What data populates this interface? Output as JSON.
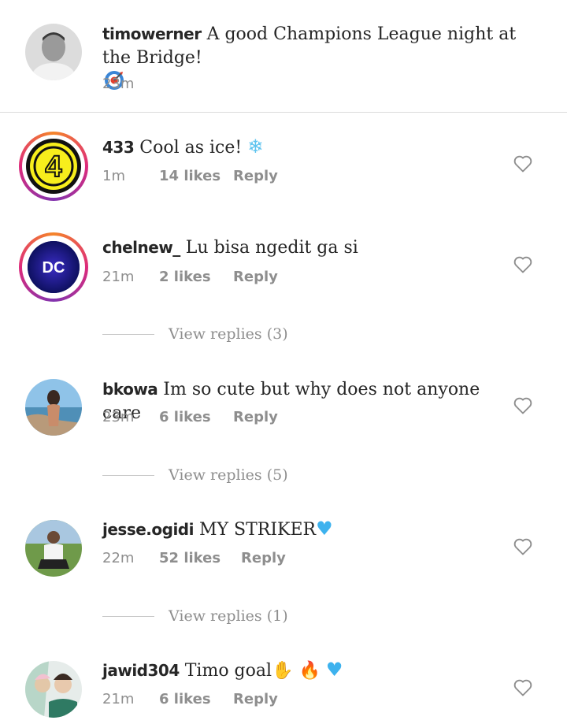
{
  "caption": {
    "username": "timowerner",
    "text": "A good Champions League night at the Bridge!",
    "time": "23m"
  },
  "comments": [
    {
      "username": "433",
      "text": "Cool as ice!",
      "time": "1m",
      "likes": "14 likes",
      "reply": "Reply"
    },
    {
      "username": "chelnew_",
      "text": "Lu bisa ngedit ga si",
      "time": "21m",
      "likes": "2 likes",
      "reply": "Reply",
      "view_replies": "View replies (3)"
    },
    {
      "username": "bkowa",
      "text": "Im so cute but why does not anyone care",
      "time": "23m",
      "likes": "6 likes",
      "reply": "Reply",
      "view_replies": "View replies (5)"
    },
    {
      "username": "jesse.ogidi",
      "text": "MY STRIKER",
      "time": "22m",
      "likes": "52 likes",
      "reply": "Reply",
      "view_replies": "View replies (1)"
    },
    {
      "username": "jawid304",
      "text": "Timo goal",
      "time": "21m",
      "likes": "6 likes",
      "reply": "Reply"
    }
  ],
  "avatar_badges": {
    "433": "4",
    "chelnew_": "DC"
  },
  "icons": {
    "target": "target-emoji-icon",
    "snowflake": "snowflake-emoji-icon",
    "blue_heart": "blue-heart-emoji-icon",
    "clap": "clap-emoji-icon",
    "fire": "fire-emoji-icon",
    "like": "heart-outline-icon"
  },
  "colors": {
    "text": "#262626",
    "meta": "#8e8e8e",
    "divider": "#dbdbdb",
    "story_ring": "#dd2a7b"
  }
}
